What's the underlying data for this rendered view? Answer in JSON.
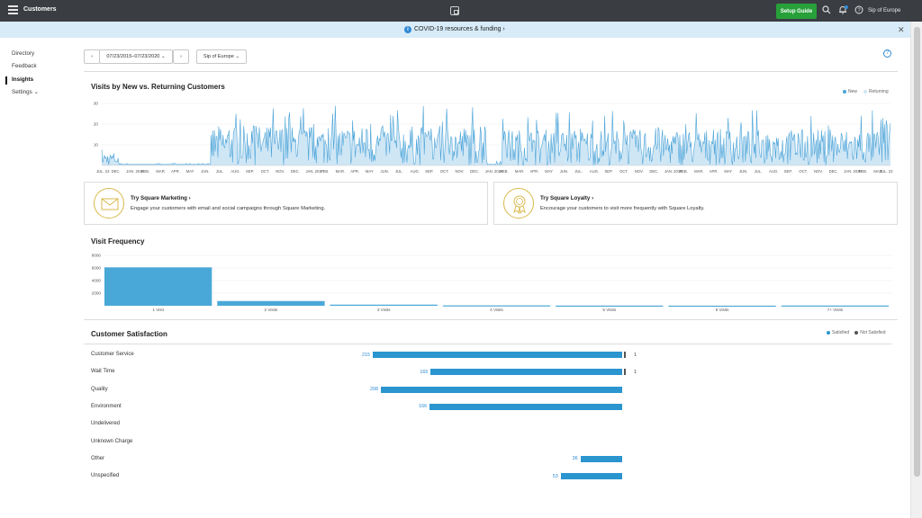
{
  "topbar": {
    "app_title": "Customers",
    "setup_button": "Setup Guide",
    "store_name": "Sip of Europe",
    "icons": [
      "menu-icon",
      "square-logo-icon",
      "search-icon",
      "bell-icon",
      "help-icon"
    ]
  },
  "banner": {
    "text": "COVID-19 resources & funding ›",
    "info_icon": "info-icon",
    "close_icon": "close-icon"
  },
  "sidebar": {
    "items": [
      {
        "label": "Directory"
      },
      {
        "label": "Feedback"
      },
      {
        "label": "Insights",
        "active": true
      },
      {
        "label": "Settings ⌄"
      }
    ]
  },
  "filters": {
    "prev": "‹",
    "date_range": "07/23/2015–07/23/2020 ⌄",
    "next": "›",
    "location": "Sip of Europe ⌄"
  },
  "colors": {
    "accent": "#4aa3d8",
    "returning": "#cfe6f5",
    "bar": "#2a95cf",
    "setup": "#28a03a"
  },
  "visits": {
    "title": "Visits by New vs. Returning Customers",
    "legend_new": "New",
    "legend_returning": "Returning",
    "y_ticks": [
      "30",
      "20",
      "10"
    ],
    "x_ticks": [
      "JUL. 23",
      "DEC.",
      "JAN. 2016",
      "FEB.",
      "MAR.",
      "APR.",
      "MAY",
      "JUN.",
      "JUL.",
      "AUG.",
      "SEP.",
      "OCT.",
      "NOV.",
      "DEC.",
      "JAN. 2017",
      "FEB.",
      "MAR.",
      "APR.",
      "MAY",
      "JUN.",
      "JUL.",
      "AUG.",
      "SEP.",
      "OCT.",
      "NOV.",
      "DEC.",
      "JAN. 2018",
      "FEB.",
      "MAR.",
      "APR.",
      "MAY",
      "JUN.",
      "JUL.",
      "AUG.",
      "SEP.",
      "OCT.",
      "NOV.",
      "DEC.",
      "JAN. 2019",
      "FEB.",
      "MAR.",
      "APR.",
      "MAY",
      "JUN.",
      "JUL.",
      "AUG.",
      "SEP.",
      "OCT.",
      "NOV.",
      "DEC.",
      "JAN. 2020",
      "FEB.",
      "MAR.",
      "JUL. 23"
    ]
  },
  "promos": [
    {
      "title": "Try Square Marketing ›",
      "text": "Engage your customers with email and social campaigns through Square Marketing.",
      "icon": "envelope-icon"
    },
    {
      "title": "Try Square Loyalty ›",
      "text": "Encourage your customers to visit more frequently with Square Loyalty.",
      "icon": "award-ribbon-icon"
    }
  ],
  "frequency": {
    "title": "Visit Frequency"
  },
  "satisfaction": {
    "title": "Customer Satisfaction",
    "legend_satisfied": "Satisfied",
    "legend_not_satisfied": "Not Satisfied",
    "rows": [
      {
        "label": "Customer Service",
        "satisfied": "215",
        "not_satisfied": "1"
      },
      {
        "label": "Wait Time",
        "satisfied": "165",
        "not_satisfied": "1"
      },
      {
        "label": "Quality",
        "satisfied": "208",
        "not_satisfied": ""
      },
      {
        "label": "Environment",
        "satisfied": "166",
        "not_satisfied": ""
      },
      {
        "label": "Undelivered",
        "satisfied": "",
        "not_satisfied": ""
      },
      {
        "label": "Unknown Charge",
        "satisfied": "",
        "not_satisfied": ""
      },
      {
        "label": "Other",
        "satisfied": "36",
        "not_satisfied": ""
      },
      {
        "label": "Unspecified",
        "satisfied": "53",
        "not_satisfied": ""
      }
    ]
  },
  "chart_data": [
    {
      "type": "area",
      "title": "Visits by New vs. Returning Customers",
      "xlabel": "",
      "ylabel": "",
      "x_range": [
        "2015-07-23",
        "2020-07-23"
      ],
      "ylim": [
        0,
        30
      ],
      "y_ticks": [
        10,
        20,
        30
      ],
      "legend": "top-right",
      "series": [
        {
          "name": "New",
          "color": "#4aa3d8",
          "segments": [
            {
              "from": "2015-07-23",
              "to": "2015-08-31",
              "typical": 4,
              "peak": 8
            },
            {
              "from": "2015-09-01",
              "to": "2016-03-31",
              "typical": 1,
              "peak": 1
            },
            {
              "from": "2016-04-01",
              "to": "2017-12-31",
              "typical": 12,
              "peak": 29
            },
            {
              "from": "2018-01-01",
              "to": "2018-02-05",
              "typical": 1,
              "peak": 2
            },
            {
              "from": "2018-02-06",
              "to": "2020-06-30",
              "typical": 11,
              "peak": 27
            },
            {
              "from": "2020-07-01",
              "to": "2020-07-23",
              "typical": 15,
              "peak": 23
            }
          ]
        },
        {
          "name": "Returning",
          "color": "#cfe6f5"
        }
      ]
    },
    {
      "type": "bar",
      "title": "Visit Frequency",
      "categories": [
        "1 Visit",
        "2 Visits",
        "3 Visits",
        "4 Visits",
        "5 Visits",
        "6 Visits",
        "7+ Visits"
      ],
      "values": [
        6100,
        750,
        180,
        60,
        30,
        15,
        40
      ],
      "y_ticks": [
        2000,
        4000,
        6000,
        8000
      ],
      "ylim": [
        0,
        8000
      ],
      "xlabel": "",
      "ylabel": ""
    },
    {
      "type": "bar",
      "title": "Customer Satisfaction",
      "orientation": "horizontal-diverging",
      "categories": [
        "Customer Service",
        "Wait Time",
        "Quality",
        "Environment",
        "Undelivered",
        "Unknown Charge",
        "Other",
        "Unspecified"
      ],
      "series": [
        {
          "name": "Satisfied",
          "values": [
            215,
            165,
            208,
            166,
            0,
            0,
            36,
            53
          ],
          "color": "#2a95cf"
        },
        {
          "name": "Not Satisfied",
          "values": [
            1,
            1,
            0,
            0,
            0,
            0,
            0,
            0
          ],
          "color": "#555555"
        }
      ],
      "legend": "top-right"
    }
  ]
}
